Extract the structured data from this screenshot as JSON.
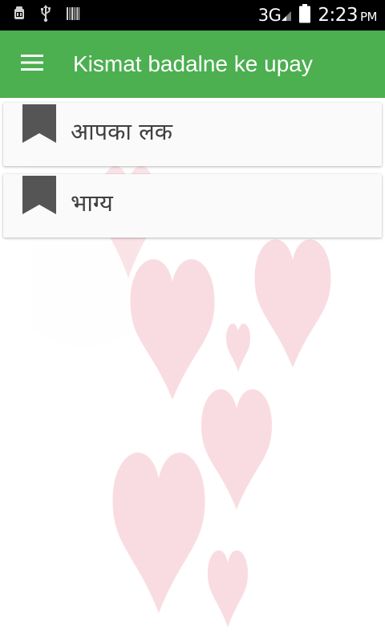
{
  "status_bar": {
    "network": "3G",
    "time": "2:23",
    "ampm": "PM",
    "icons": [
      "android-debug-icon",
      "usb-icon",
      "barcode-icon",
      "signal-icon",
      "battery-icon"
    ]
  },
  "app_bar": {
    "title": "Kismat badalne ke upay",
    "menu_icon": "hamburger-menu-icon",
    "color": "#4caf50"
  },
  "list": {
    "items": [
      {
        "label": "आपका लक",
        "icon": "bookmark-icon"
      },
      {
        "label": "भाग्य",
        "icon": "bookmark-icon"
      }
    ]
  },
  "colors": {
    "status_bar": "#000000",
    "card": "#fafafa",
    "card_text": "#404040",
    "bookmark": "#555555",
    "heart": "#f8d7dc"
  }
}
